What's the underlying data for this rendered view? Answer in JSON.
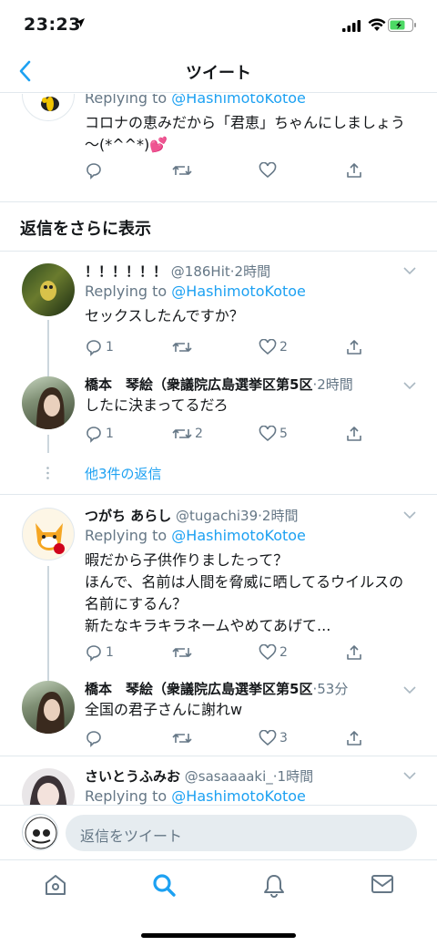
{
  "status": {
    "time": "23:23"
  },
  "nav": {
    "title": "ツイート"
  },
  "top_tweet": {
    "replying_prefix": "Replying to ",
    "replying_handle": "@HashimotoKotoe",
    "text_line1": "コロナの恵みだから「君恵」ちゃんにしましょう",
    "text_line2": "〜(*^^*)💕"
  },
  "more_replies_title": "返信をさらに表示",
  "tweets": [
    {
      "name": "！！！！！！",
      "handle": "@186Hit",
      "time": "2時間",
      "replying_prefix": "Replying to ",
      "replying_handle": "@HashimotoKotoe",
      "lines": [
        "セックスしたんですか？"
      ],
      "replies": "1",
      "retweets": "",
      "likes": "2"
    },
    {
      "name": "橋本　琴絵（衆議院広島選挙区第5区",
      "handle": "",
      "time": "2時間",
      "lines": [
        "したに決まってるだろ"
      ],
      "replies": "1",
      "retweets": "2",
      "likes": "5"
    },
    {
      "name": "つがち あらし",
      "handle": "@tugachi39",
      "time": "2時間",
      "replying_prefix": "Replying to ",
      "replying_handle": "@HashimotoKotoe",
      "lines": [
        "暇だから子供作りましたって？",
        "ほんで、名前は人間を脅威に晒してるウイルスの",
        "名前にするん？",
        "新たなキラキラネームやめてあげて..."
      ],
      "replies": "1",
      "retweets": "",
      "likes": "2"
    },
    {
      "name": "橋本　琴絵（衆議院広島選挙区第5区",
      "handle": "",
      "time": "53分",
      "lines": [
        "全国の君子さんに謝れw"
      ],
      "replies": "",
      "retweets": "",
      "likes": "3"
    },
    {
      "name": "さいとうふみお",
      "handle": "@sasaaaaki_",
      "time": "1時間",
      "replying_prefix": "Replying to ",
      "replying_handle": "@HashimotoKotoe"
    }
  ],
  "more_link": "他3件の返信",
  "sep_dot": "·",
  "composer": {
    "placeholder": "返信をツイート"
  },
  "colors": {
    "accent": "#1da1f2",
    "muted": "#657786",
    "border": "#e1e8ed"
  },
  "icons": [
    "back-chevron-icon",
    "reply-icon",
    "retweet-icon",
    "like-icon",
    "share-icon",
    "chevron-down-icon",
    "home-icon",
    "search-icon",
    "notifications-icon",
    "messages-icon"
  ]
}
